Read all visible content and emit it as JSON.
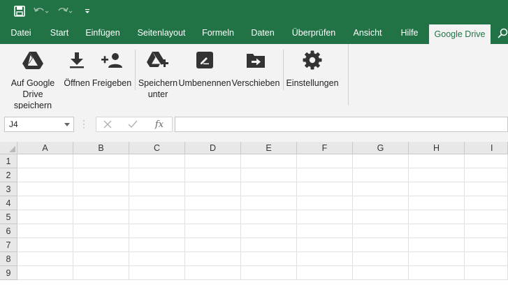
{
  "colors": {
    "accent": "#217346",
    "ribbon_bg": "#f3f3f3"
  },
  "qat": {
    "icons": [
      "save-icon",
      "undo-icon",
      "redo-icon",
      "customize-quick-access-icon"
    ]
  },
  "tabs": [
    "Datei",
    "Start",
    "Einfügen",
    "Seitenlayout",
    "Formeln",
    "Daten",
    "Überprüfen",
    "Ansicht",
    "Hilfe",
    "Google Drive"
  ],
  "active_tab": "Google Drive",
  "ribbon": {
    "save_to_drive": "Auf Google\nDrive speichern",
    "open": "Öffnen",
    "share": "Freigeben",
    "save_as": "Speichern\nunter",
    "rename": "Umbenennen",
    "move": "Verschieben",
    "settings": "Einstellungen"
  },
  "formula_bar": {
    "name_box": "J4",
    "fx_label": "fx",
    "formula": ""
  },
  "sheet": {
    "columns": [
      "A",
      "B",
      "C",
      "D",
      "E",
      "F",
      "G",
      "H",
      "I"
    ],
    "rows": [
      "1",
      "2",
      "3",
      "4",
      "5",
      "6",
      "7",
      "8",
      "9"
    ]
  }
}
